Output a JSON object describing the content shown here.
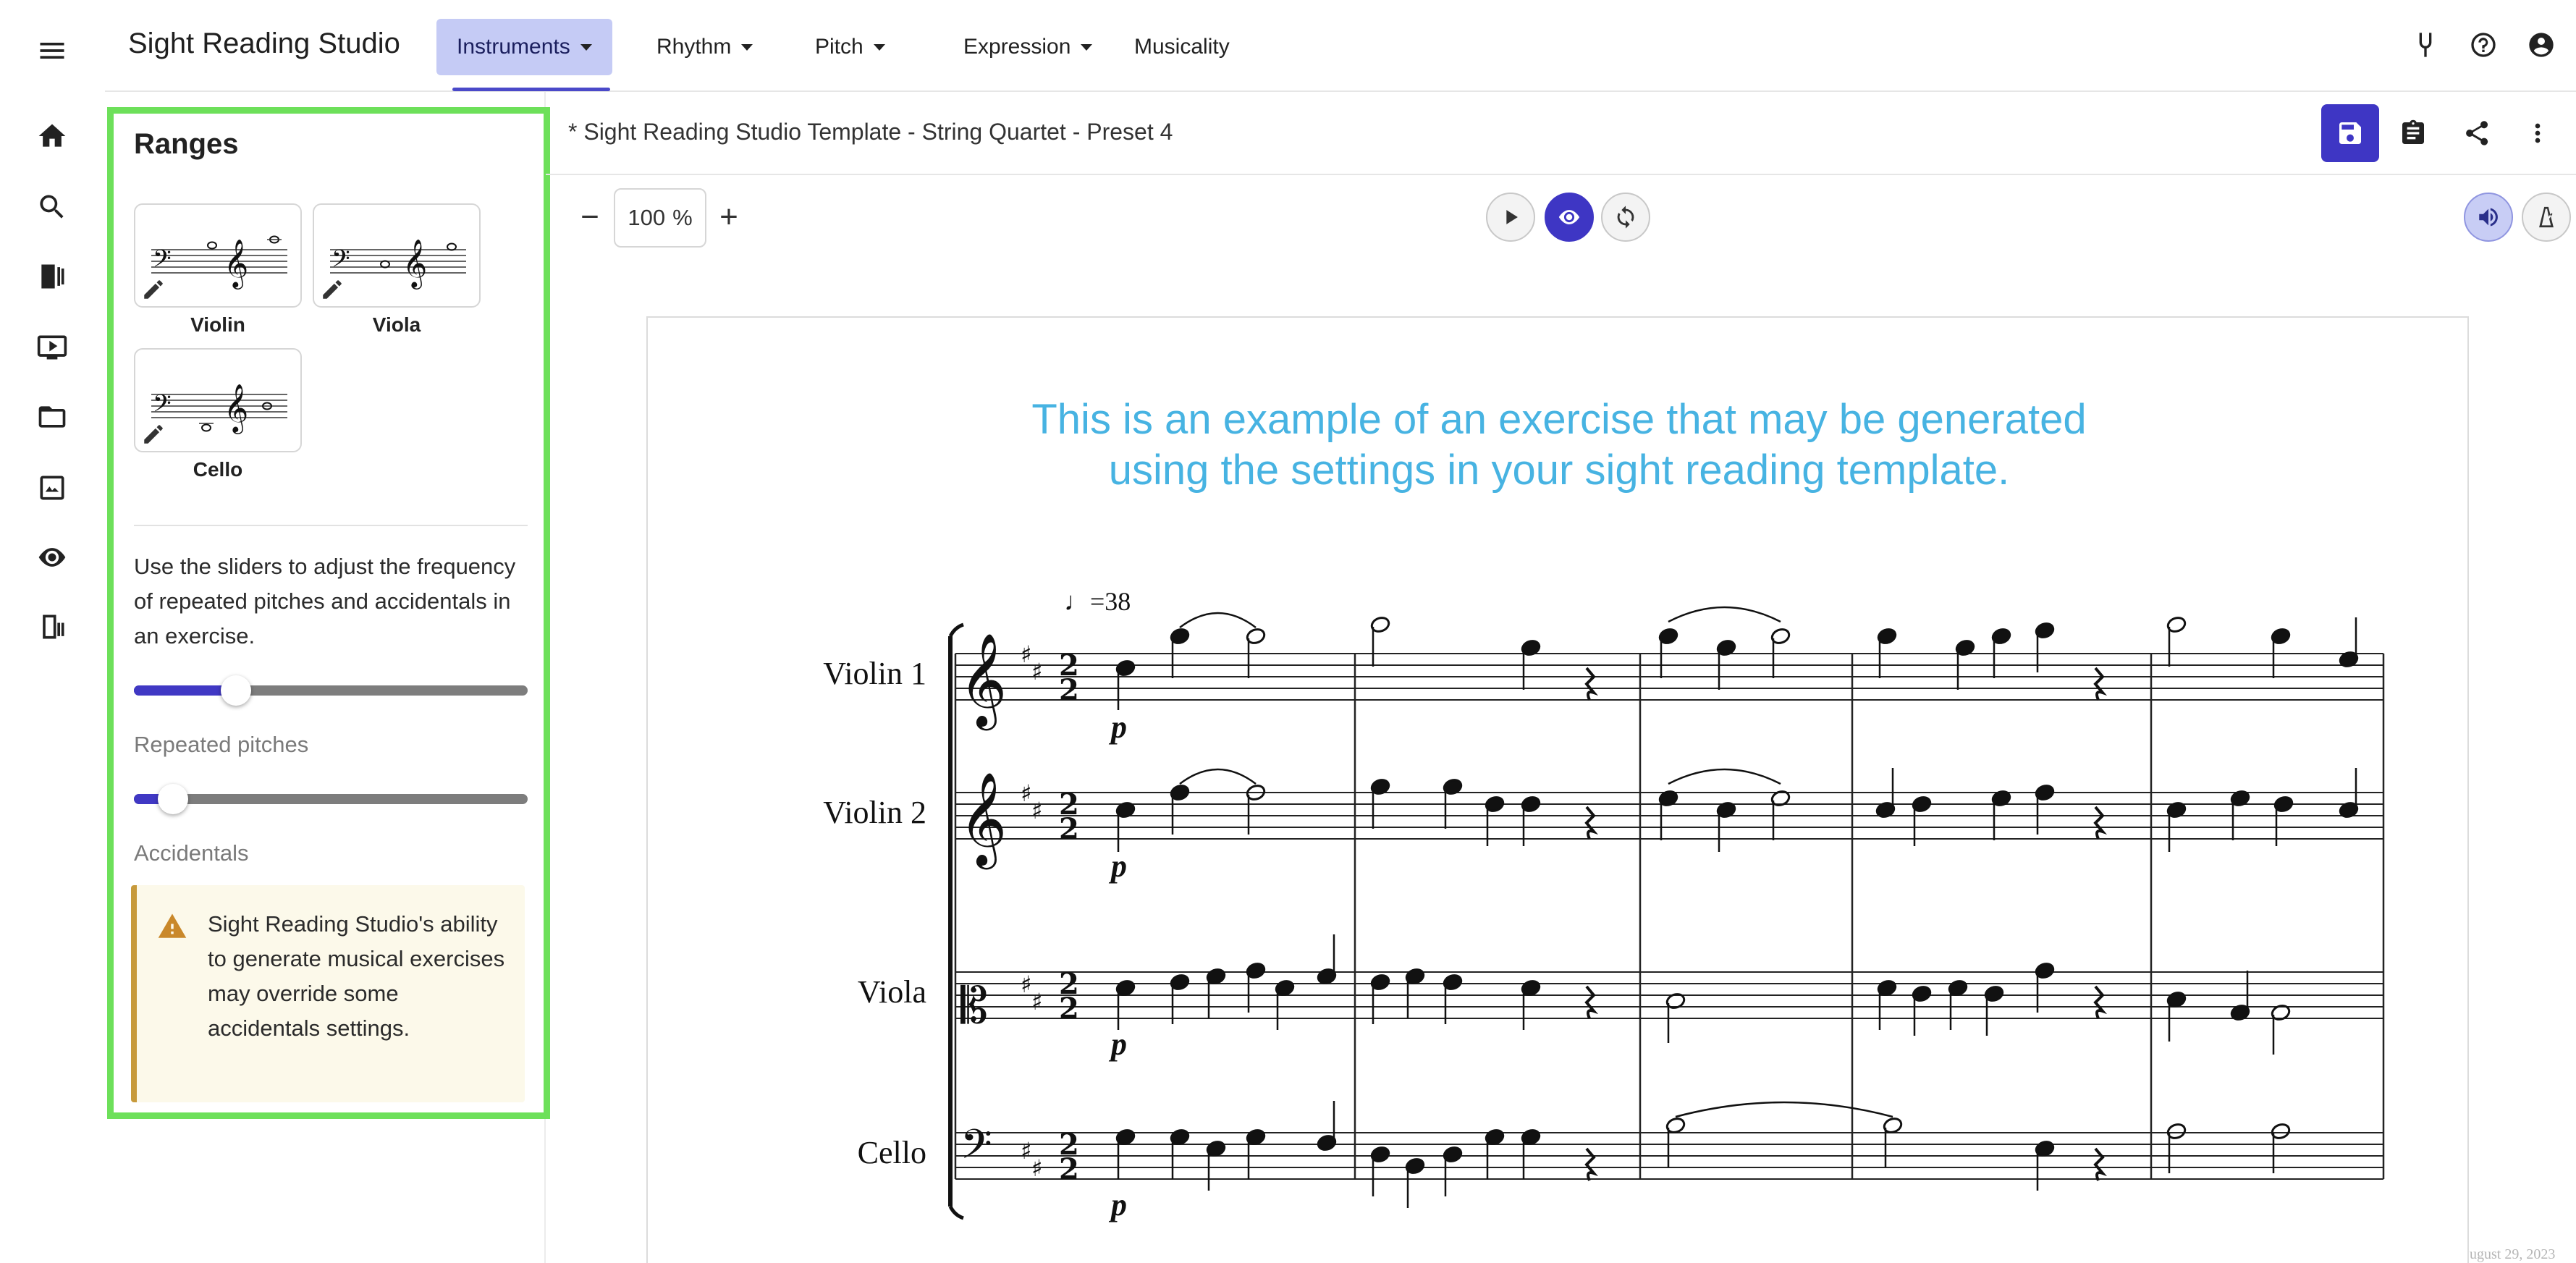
{
  "header": {
    "app_title": "Sight Reading Studio",
    "tabs": [
      {
        "label": "Instruments",
        "has_menu": true,
        "active": true
      },
      {
        "label": "Rhythm",
        "has_menu": true
      },
      {
        "label": "Pitch",
        "has_menu": true
      },
      {
        "label": "Expression",
        "has_menu": true
      },
      {
        "label": "Musicality",
        "has_menu": false
      }
    ],
    "icons": [
      "tuning-fork-icon",
      "help-icon",
      "account-icon"
    ]
  },
  "rail": {
    "icons": [
      "menu-icon",
      "home-icon",
      "search-icon",
      "library-icon",
      "video-icon",
      "folder-icon",
      "assignment-icon",
      "ear-icon",
      "exit-icon"
    ]
  },
  "panel": {
    "title": "Ranges",
    "instruments": [
      {
        "label": "Violin"
      },
      {
        "label": "Viola"
      },
      {
        "label": "Cello"
      }
    ],
    "description": "Use the sliders to adjust the frequency of repeated pitches and accidentals in an exercise.",
    "sliders": [
      {
        "label": "Repeated pitches",
        "value": 0.26
      },
      {
        "label": "Accidentals",
        "value": 0.1
      }
    ],
    "warning": "Sight Reading Studio's ability to generate musical exercises may override some accidentals settings."
  },
  "document": {
    "title": "* Sight Reading Studio Template - String Quartet - Preset 4",
    "zoom_value": "100",
    "zoom_unit": "%",
    "accent_color": "#3e36c4"
  },
  "score": {
    "caption_line1": "This is an example of an exercise that may be generated",
    "caption_line2": "using the settings in your sight reading template.",
    "tempo": "♩=38",
    "dynamic": "p",
    "time_signature": "2/2",
    "parts": [
      "Violin 1",
      "Violin 2",
      "Viola",
      "Cello"
    ],
    "footer": "ugust 29, 2023"
  }
}
